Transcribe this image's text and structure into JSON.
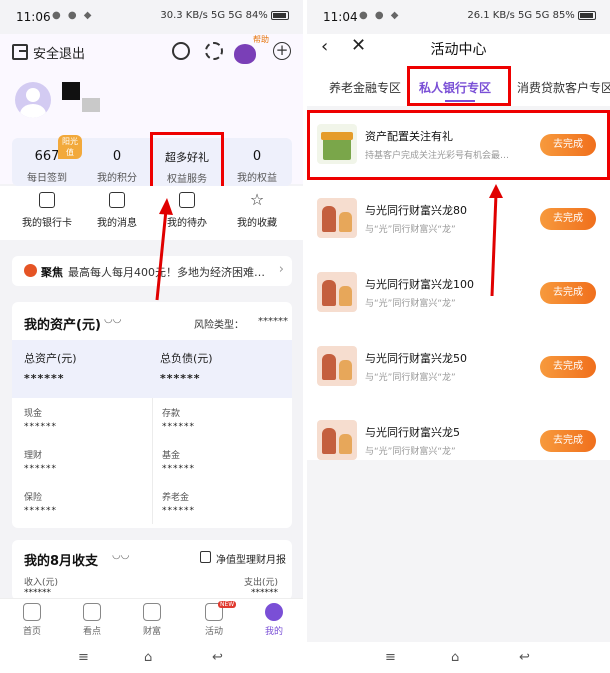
{
  "left": {
    "status": {
      "time": "11:06",
      "net": "30.3 KB/s",
      "signal": "5G 5G",
      "battery": "84%"
    },
    "header": {
      "logout_label": "安全退出",
      "help_label": "帮助"
    },
    "stats": [
      {
        "value": "667",
        "label": "每日签到",
        "badge": "阳光值"
      },
      {
        "value": "0",
        "label": "我的积分"
      },
      {
        "value": "超多好礼",
        "label": "权益服务"
      },
      {
        "value": "0",
        "label": "我的权益"
      }
    ],
    "quick": [
      {
        "label": "我的银行卡",
        "icon": "card-icon"
      },
      {
        "label": "我的消息",
        "icon": "message-icon"
      },
      {
        "label": "我的待办",
        "icon": "calendar-icon"
      },
      {
        "label": "我的收藏",
        "icon": "star-icon"
      }
    ],
    "banner": {
      "tag": "聚焦",
      "text": "最高每人每月400元！多地为经济困难…"
    },
    "assets": {
      "title": "我的资产(元)",
      "risk_label": "风险类型：",
      "risk_value": "******",
      "total_assets_label": "总资产(元)",
      "total_assets_value": "******",
      "total_debt_label": "总负债(元)",
      "total_debt_value": "******",
      "items": [
        {
          "label": "现金",
          "value": "******"
        },
        {
          "label": "存款",
          "value": "******"
        },
        {
          "label": "理财",
          "value": "******"
        },
        {
          "label": "基金",
          "value": "******"
        },
        {
          "label": "保险",
          "value": "******"
        },
        {
          "label": "养老金",
          "value": "******"
        }
      ]
    },
    "income": {
      "title": "我的8月收支",
      "report": "净值型理财月报",
      "in_label": "收入(元)",
      "out_label": "支出(元)",
      "in_value": "******",
      "out_value": "******"
    },
    "tabs": [
      {
        "label": "首页"
      },
      {
        "label": "看点"
      },
      {
        "label": "财富"
      },
      {
        "label": "活动",
        "badge": "NEW"
      },
      {
        "label": "我的"
      }
    ]
  },
  "right": {
    "status": {
      "time": "11:04",
      "net": "26.1 KB/s",
      "signal": "5G 5G",
      "battery": "85%"
    },
    "title": "活动中心",
    "tabs": [
      "养老金融专区",
      "私人银行专区",
      "消费贷款客户专区"
    ],
    "activities": [
      {
        "name": "资产配置关注有礼",
        "desc": "持基客户完成关注光彩号有机会最…",
        "button": "去完成"
      },
      {
        "name": "与光同行财富兴龙80",
        "desc": "与“光”同行财富兴“龙”",
        "button": "去完成"
      },
      {
        "name": "与光同行财富兴龙100",
        "desc": "与“光”同行财富兴“龙”",
        "button": "去完成"
      },
      {
        "name": "与光同行财富兴龙50",
        "desc": "与“光”同行财富兴“龙”",
        "button": "去完成"
      },
      {
        "name": "与光同行财富兴龙5",
        "desc": "与“光”同行财富兴“龙”",
        "button": "去完成"
      }
    ]
  },
  "colors": {
    "accent": "#7a4fd6",
    "button": "#f37b25",
    "highlight": "#e00000"
  }
}
